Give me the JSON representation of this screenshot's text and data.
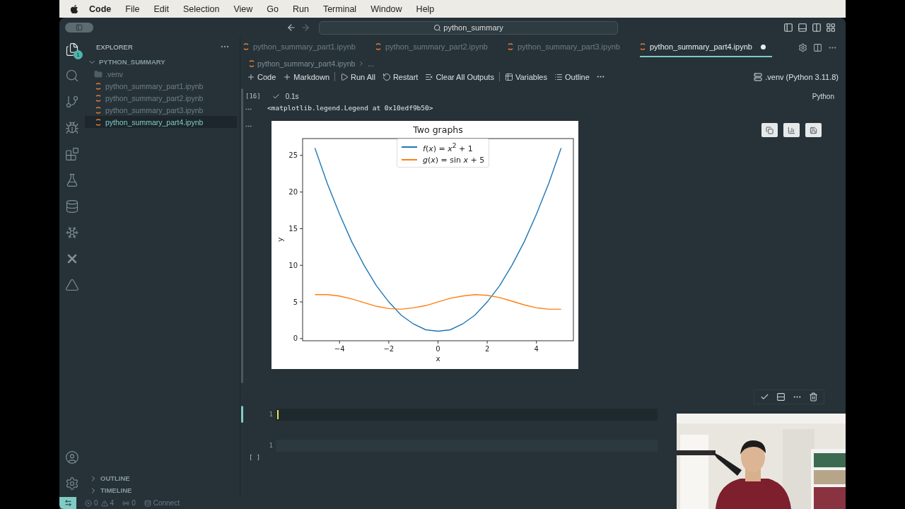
{
  "menu_bar": {
    "app": "Code",
    "items": [
      "File",
      "Edit",
      "Selection",
      "View",
      "Go",
      "Run",
      "Terminal",
      "Window",
      "Help"
    ]
  },
  "title_bar": {
    "search": "python_summary"
  },
  "activity_bar": {
    "items": [
      {
        "kind": "files",
        "selected": true,
        "badge": "1"
      },
      {
        "kind": "search",
        "selected": false
      },
      {
        "kind": "source-control",
        "selected": false
      },
      {
        "kind": "run",
        "selected": false
      },
      {
        "kind": "extensions",
        "selected": false
      },
      {
        "kind": "testing",
        "selected": false
      },
      {
        "kind": "database",
        "selected": false
      },
      {
        "kind": "snowflake",
        "selected": false
      },
      {
        "kind": "cross",
        "selected": false
      },
      {
        "kind": "triangle",
        "selected": false
      }
    ],
    "bottom": [
      {
        "kind": "account"
      },
      {
        "kind": "settings"
      }
    ]
  },
  "sidebar": {
    "title": "EXPLORER",
    "folder": "PYTHON_SUMMARY",
    "expanded": true,
    "files": [
      {
        "name": ".venv",
        "kind": "folder",
        "selected": false
      },
      {
        "name": "python_summary_part1.ipynb",
        "kind": "notebook",
        "selected": false
      },
      {
        "name": "python_summary_part2.ipynb",
        "kind": "notebook",
        "selected": false
      },
      {
        "name": "python_summary_part3.ipynb",
        "kind": "notebook",
        "selected": false
      },
      {
        "name": "python_summary_part4.ipynb",
        "kind": "notebook",
        "selected": true
      }
    ],
    "sections": [
      {
        "label": "OUTLINE",
        "expanded": false
      },
      {
        "label": "TIMELINE",
        "expanded": false
      }
    ]
  },
  "tabs": [
    {
      "label": "python_summary_part1.ipynb",
      "selected": false,
      "dirty": false
    },
    {
      "label": "python_summary_part2.ipynb",
      "selected": false,
      "dirty": false
    },
    {
      "label": "python_summary_part3.ipynb",
      "selected": false,
      "dirty": false
    },
    {
      "label": "python_summary_part4.ipynb",
      "selected": true,
      "dirty": true
    }
  ],
  "breadcrumb": [
    "python_summary_part4.ipynb",
    "..."
  ],
  "toolbar": {
    "actions": [
      {
        "kind": "add",
        "label": "Code"
      },
      {
        "kind": "add",
        "label": "Markdown"
      },
      {
        "kind": "run",
        "label": "Run All"
      },
      {
        "kind": "restart",
        "label": "Restart"
      },
      {
        "kind": "clear",
        "label": "Clear All Outputs"
      },
      {
        "kind": "variables",
        "label": "Variables"
      },
      {
        "kind": "outline",
        "label": "Outline"
      }
    ],
    "kernel": ".venv (Python 3.11.8)"
  },
  "cells": [
    {
      "kind": "executed",
      "execution_count": "[16]",
      "succeeded": true,
      "duration": "0.1s",
      "language": "Python",
      "outputs": [
        {
          "kind": "text",
          "text": "<matplotlib.legend.Legend at 0x10edf9b50>"
        },
        {
          "kind": "chart",
          "chart_data": {
            "type": "line",
            "title": "Two graphs",
            "xlabel": "x",
            "ylabel": "y",
            "x": [
              -5,
              -4.5,
              -4,
              -3.5,
              -3,
              -2.5,
              -2,
              -1.5,
              -1,
              -0.5,
              0,
              0.5,
              1,
              1.5,
              2,
              2.5,
              3,
              3.5,
              4,
              4.5,
              5
            ],
            "series": [
              {
                "name": "*f*(*x*) = *x*$^{2}$ + 1",
                "color": "#1f77b4",
                "values": [
                  26,
                  21.2,
                  17,
                  13.2,
                  10,
                  7.2,
                  5,
                  3.2,
                  2,
                  1.2,
                  1,
                  1.2,
                  2,
                  3.2,
                  5,
                  7.2,
                  10,
                  13.2,
                  17,
                  21.2,
                  26
                ]
              },
              {
                "name": "*g*(*x*) = sin *x* + 5",
                "color": "#ff7f0e",
                "values": [
                  6,
                  6,
                  5.8,
                  5.4,
                  4.9,
                  4.4,
                  4.1,
                  4,
                  4.2,
                  4.5,
                  5,
                  5.5,
                  5.8,
                  6,
                  5.9,
                  5.6,
                  5.1,
                  4.6,
                  4.2,
                  4,
                  4
                ]
              }
            ],
            "legend": true,
            "xlim": [
              -5.5,
              5.5
            ],
            "ylim": [
              -0.3,
              27.3
            ],
            "xticks": [
              -4,
              -2,
              0,
              2,
              4
            ],
            "yticks": [
              0,
              5,
              10,
              15,
              20,
              25
            ]
          }
        }
      ]
    },
    {
      "kind": "editing",
      "focused": true,
      "line_numbers": [
        "1"
      ]
    },
    {
      "kind": "pending",
      "focused": false,
      "line_numbers": [
        "1"
      ],
      "execution_count": "[ ]"
    }
  ],
  "status_bar": {
    "errors": "0",
    "warnings": "4",
    "ports": "0",
    "connect": "Connect"
  },
  "webcam": {
    "kind": "picture"
  }
}
